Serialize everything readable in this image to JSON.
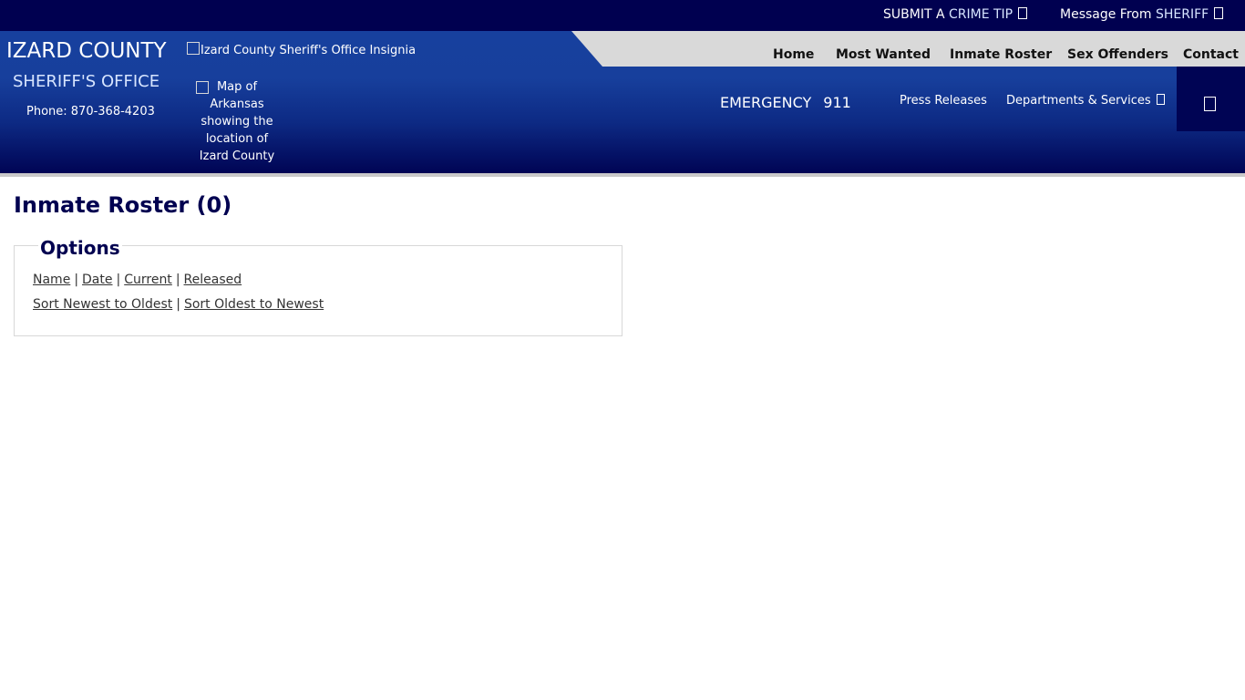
{
  "topbar": {
    "crime_tip_prefix": "SUBMIT A ",
    "crime_tip_accent": "CRIME TIP",
    "message_prefix": "Message From ",
    "message_accent": "SHERIFF"
  },
  "brand": {
    "county": "IZARD COUNTY",
    "office": "SHERIFF'S OFFICE",
    "phone": "Phone: 870-368-4203",
    "insignia_alt": "Izard County Sheriff's Office Insignia",
    "map_alt": "Map of Arkansas showing the location of Izard County"
  },
  "main_nav": [
    "Home",
    "Most Wanted",
    "Inmate Roster",
    "Sex Offenders",
    "Contact"
  ],
  "secondary_nav": {
    "emergency_label": "EMERGENCY",
    "emergency_number": "911",
    "press_releases": "Press Releases",
    "departments": "Departments & Services"
  },
  "main": {
    "title": "Inmate Roster (0)",
    "options_legend": "Options",
    "filter_links": [
      "Name",
      "Date",
      "Current",
      "Released"
    ],
    "sort_links": [
      "Sort Newest to Oldest",
      "Sort Oldest to Newest"
    ]
  },
  "icons": {
    "crime_tip": "external-link-icon",
    "message": "external-link-icon",
    "departments": "chevron-down-icon",
    "menu": "menu-icon"
  },
  "colors": {
    "topbar": "#000050",
    "header_blue": "#17409e",
    "header_dark": "#000454",
    "title": "#000050",
    "nav_gray": "#d9d9d9"
  }
}
